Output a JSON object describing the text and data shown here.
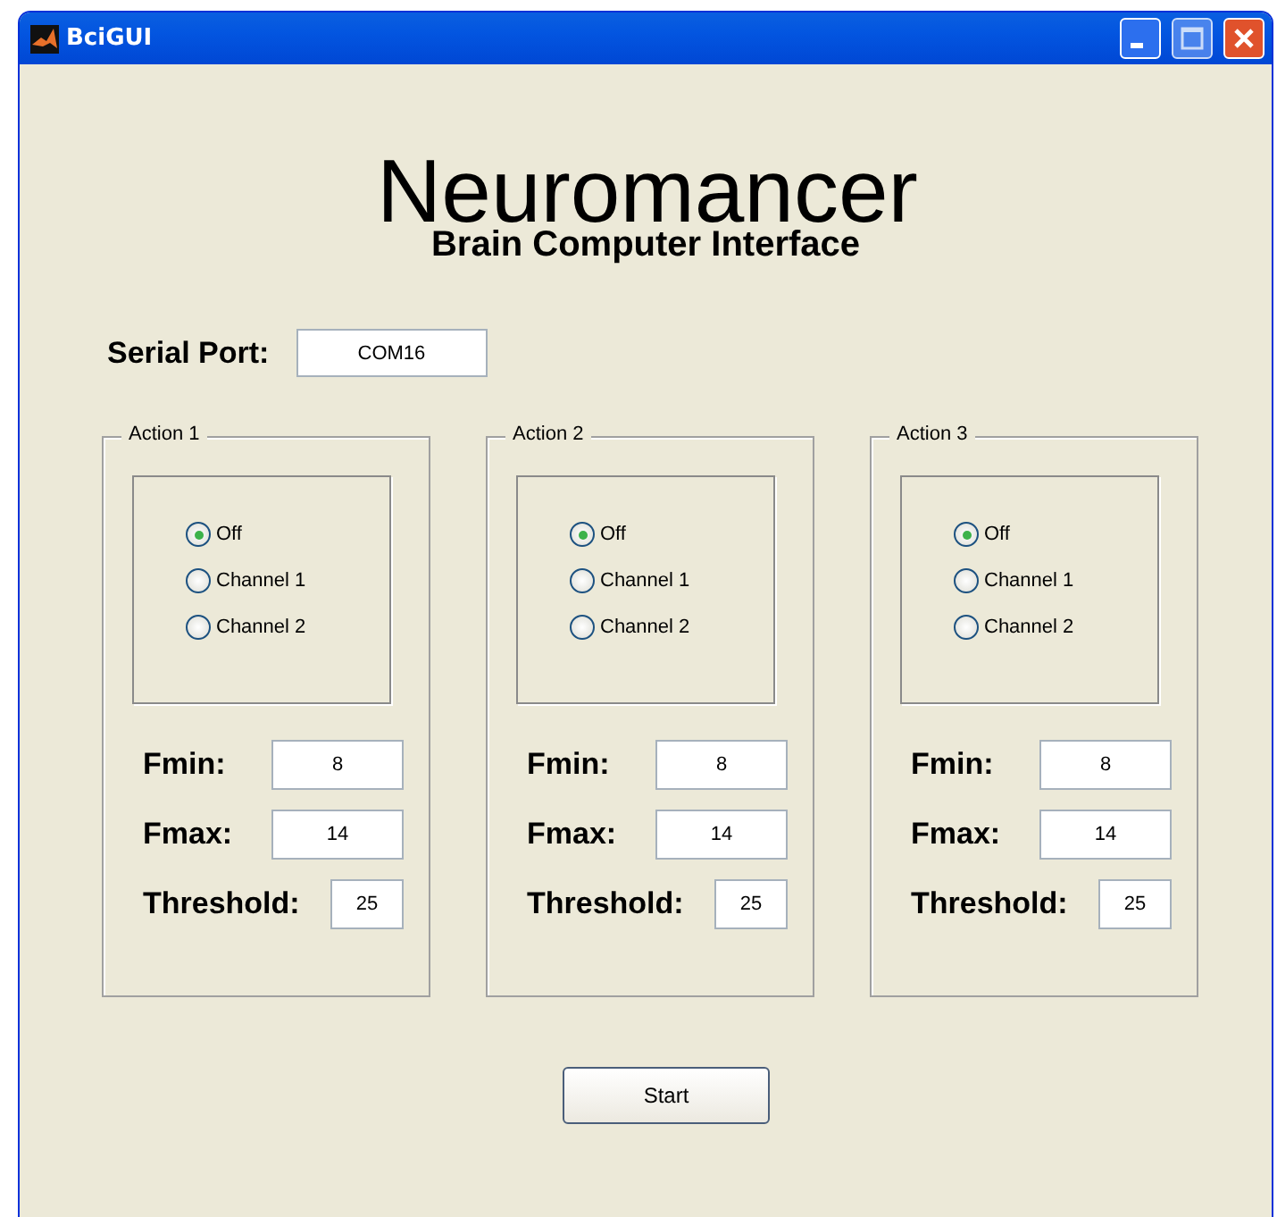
{
  "window": {
    "title": "BciGUI"
  },
  "heading": {
    "title": "Neuromancer",
    "subtitle": "Brain Computer Interface"
  },
  "serial_port": {
    "label": "Serial Port:",
    "value": "COM16"
  },
  "actions": [
    {
      "title": "Action 1",
      "options": [
        {
          "label": "Off",
          "selected": true
        },
        {
          "label": "Channel 1",
          "selected": false
        },
        {
          "label": "Channel 2",
          "selected": false
        }
      ],
      "fields": [
        {
          "kind": "wide",
          "label": "Fmin:",
          "value": "8"
        },
        {
          "kind": "wide",
          "label": "Fmax:",
          "value": "14"
        },
        {
          "kind": "narrow",
          "label": "Threshold:",
          "value": "25"
        }
      ]
    },
    {
      "title": "Action 2",
      "options": [
        {
          "label": "Off",
          "selected": true
        },
        {
          "label": "Channel 1",
          "selected": false
        },
        {
          "label": "Channel 2",
          "selected": false
        }
      ],
      "fields": [
        {
          "kind": "wide",
          "label": "Fmin:",
          "value": "8"
        },
        {
          "kind": "wide",
          "label": "Fmax:",
          "value": "14"
        },
        {
          "kind": "narrow",
          "label": "Threshold:",
          "value": "25"
        }
      ]
    },
    {
      "title": "Action 3",
      "options": [
        {
          "label": "Off",
          "selected": true
        },
        {
          "label": "Channel 1",
          "selected": false
        },
        {
          "label": "Channel 2",
          "selected": false
        }
      ],
      "fields": [
        {
          "kind": "wide",
          "label": "Fmin:",
          "value": "8"
        },
        {
          "kind": "wide",
          "label": "Fmax:",
          "value": "14"
        },
        {
          "kind": "narrow",
          "label": "Threshold:",
          "value": "25"
        }
      ]
    }
  ],
  "buttons": [
    {
      "label": "Start"
    }
  ]
}
